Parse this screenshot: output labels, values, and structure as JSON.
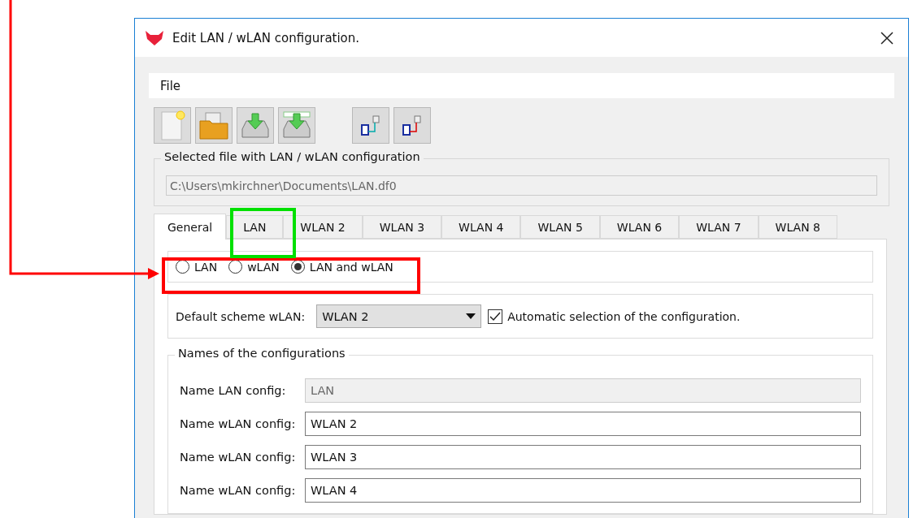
{
  "window": {
    "title": "Edit LAN / wLAN configuration."
  },
  "menu": [
    "File"
  ],
  "file_group": {
    "title": "Selected file with LAN / wLAN configuration",
    "value": "C:\\Users\\mkirchner\\Documents\\LAN.df0"
  },
  "tabs": [
    {
      "label": "General",
      "selected": true
    },
    {
      "label": "LAN",
      "selected": false
    },
    {
      "label": "WLAN 2",
      "selected": false
    },
    {
      "label": "WLAN 3",
      "selected": false
    },
    {
      "label": "WLAN 4",
      "selected": false
    },
    {
      "label": "WLAN 5",
      "selected": false
    },
    {
      "label": "WLAN 6",
      "selected": false
    },
    {
      "label": "WLAN 7",
      "selected": false
    },
    {
      "label": "WLAN 8",
      "selected": false
    }
  ],
  "mode_options": [
    {
      "label": "LAN",
      "selected": false
    },
    {
      "label": "wLAN",
      "selected": false
    },
    {
      "label": "LAN and wLAN",
      "selected": true
    }
  ],
  "default_scheme": {
    "label": "Default scheme wLAN:",
    "value": "WLAN 2"
  },
  "auto_select": {
    "label": "Automatic selection of the configuration.",
    "checked": true
  },
  "names_group": {
    "title": "Names of the configurations",
    "rows": [
      {
        "label": "Name LAN config:",
        "value": "LAN",
        "disabled": true
      },
      {
        "label": "Name wLAN config:",
        "value": "WLAN 2",
        "disabled": false
      },
      {
        "label": "Name wLAN config:",
        "value": "WLAN 3",
        "disabled": false
      },
      {
        "label": "Name wLAN config:",
        "value": "WLAN 4",
        "disabled": false
      }
    ]
  }
}
